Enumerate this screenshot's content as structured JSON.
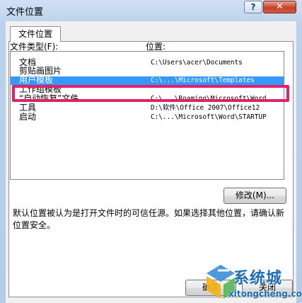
{
  "window": {
    "title": "文件位置",
    "help_label": "?",
    "close_label": "✕"
  },
  "tab": {
    "label": "文件位置"
  },
  "columns": {
    "type_label": "文件类型(F):",
    "location_label": "位置:"
  },
  "list": {
    "rows": [
      {
        "type": "文档",
        "path": "C:\\Users\\acer\\Documents"
      },
      {
        "type": "剪贴画图片",
        "path": ""
      },
      {
        "type": "用户模板",
        "path": "C:\\...\\Microsoft\\Templates",
        "selected": true
      },
      {
        "type": "工作组模板",
        "path": ""
      },
      {
        "type": "“自动恢复”文件",
        "path": "C:\\...\\Roaming\\Microsoft\\Word"
      },
      {
        "type": "工具",
        "path": "D:\\软件\\Office 2007\\Office12"
      },
      {
        "type": "启动",
        "path": "C:\\...\\Microsoft\\Word\\STARTUP"
      }
    ]
  },
  "buttons": {
    "modify": "修改(M)...",
    "ok": "确定",
    "cancel": "关闭"
  },
  "info_text": "默认位置被认为是打开文件时的可信任源。如果选择其他位置，请确认新位置安全。",
  "watermark": {
    "text": "系统城",
    "url": "xitongcheng.com"
  },
  "colors": {
    "selection": "#3399ff",
    "highlight_border": "#e0206a",
    "watermark": "#1e6fb7"
  }
}
